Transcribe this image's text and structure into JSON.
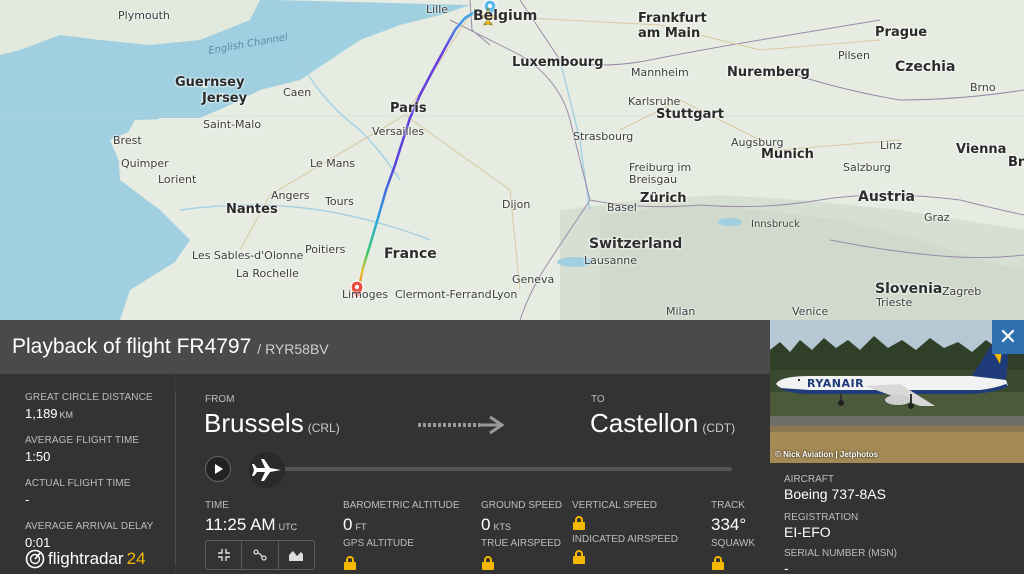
{
  "map": {
    "labels": {
      "plymouth": "Plymouth",
      "english_channel": "English Channel",
      "guernsey": "Guernsey",
      "jersey": "Jersey",
      "caen": "Caen",
      "saint_malo": "Saint-Malo",
      "brest": "Brest",
      "quimper": "Quimper",
      "lorient": "Lorient",
      "nantes": "Nantes",
      "angers": "Angers",
      "les_sables": "Les Sables-d'Olonne",
      "la_rochelle": "La Rochelle",
      "poitiers": "Poitiers",
      "tours": "Tours",
      "le_mans": "Le Mans",
      "paris": "Paris",
      "versailles": "Versailles",
      "lille": "Lille",
      "belgium": "Belgium",
      "luxembourg": "Luxembourg",
      "frankfurt": "Frankfurt\nam Main",
      "mannheim": "Mannheim",
      "karlsruhe": "Karlsruhe",
      "stuttgart": "Stuttgart",
      "strasbourg": "Strasbourg",
      "freiburg": "Freiburg im\nBreisgau",
      "basel": "Basel",
      "zurich": "Zürich",
      "dijon": "Dijon",
      "switzerland": "Switzerland",
      "lausanne": "Lausanne",
      "geneva": "Geneva",
      "lyon": "Lyon",
      "france": "France",
      "clermont": "Clermont-Ferrand",
      "limoges": "Limoges",
      "milan": "Milan",
      "nuremberg": "Nuremberg",
      "augsburg": "Augsburg",
      "munich": "Munich",
      "innsbruck": "Innsbruck",
      "prague": "Prague",
      "czechia": "Czechia",
      "pilsen": "Pilsen",
      "brno": "Brno",
      "linz": "Linz",
      "salzburg": "Salzburg",
      "austria": "Austria",
      "vienna": "Vienna",
      "graz": "Graz",
      "slovenia": "Slovenia",
      "zagreb": "Zagreb",
      "trieste": "Trieste",
      "venice": "Venice",
      "bra": "Bra"
    }
  },
  "header": {
    "title": "Playback of flight FR4797",
    "callsign": "/ RYR58BV"
  },
  "stats": {
    "distance_label": "GREAT CIRCLE DISTANCE",
    "distance_value": "1,189",
    "distance_unit": "KM",
    "avg_time_label": "AVERAGE FLIGHT TIME",
    "avg_time_value": "1:50",
    "actual_time_label": "ACTUAL FLIGHT TIME",
    "actual_time_value": "-",
    "delay_label": "AVERAGE ARRIVAL DELAY",
    "delay_value": "0:01"
  },
  "brand": {
    "name": "flightradar",
    "num": "24"
  },
  "route": {
    "from_label": "FROM",
    "from_city": "Brussels",
    "from_code": "(CRL)",
    "to_label": "TO",
    "to_city": "Castellon",
    "to_code": "(CDT)"
  },
  "telemetry": {
    "time_label": "TIME",
    "time_value": "11:25 AM",
    "time_unit": "UTC",
    "baro_label": "BAROMETRIC ALTITUDE",
    "baro_value": "0",
    "baro_unit": "FT",
    "gps_label": "GPS ALTITUDE",
    "ground_label": "GROUND SPEED",
    "ground_value": "0",
    "ground_unit": "KTS",
    "tas_label": "TRUE AIRSPEED",
    "vs_label": "VERTICAL SPEED",
    "ias_label": "INDICATED AIRSPEED",
    "track_label": "TRACK",
    "track_value": "334°",
    "squawk_label": "SQUAWK"
  },
  "aircraft": {
    "photo_credit": "© Nick Aviation | Jetphotos",
    "airline_livery": "RYANAIR",
    "aircraft_label": "AIRCRAFT",
    "aircraft_value": "Boeing 737-8AS",
    "registration_label": "REGISTRATION",
    "registration_value": "EI-EFO",
    "msn_label": "SERIAL NUMBER (MSN)",
    "msn_value": "-"
  },
  "colors": {
    "accent_yellow": "#f5b800",
    "close_blue": "#2f6fb0",
    "panel_dark": "#333333"
  }
}
